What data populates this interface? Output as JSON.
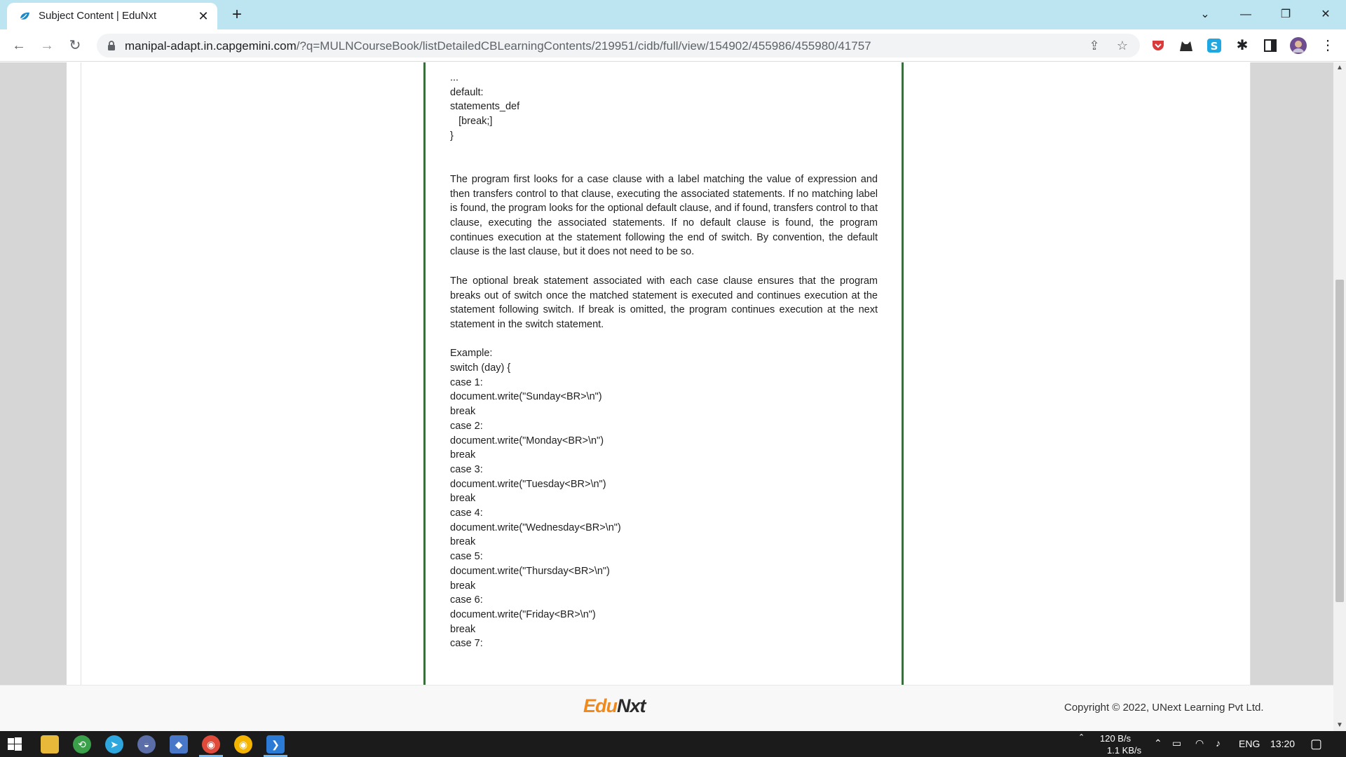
{
  "browser": {
    "tab_title": "Subject Content | EduNxt",
    "url_host": "manipal-adapt.in.capgemini.com",
    "url_path": "/?q=MULNCourseBook/listDetailedCBLearningContents/219951/cidb/full/view/154902/455986/455980/41757"
  },
  "content": {
    "code_top": [
      "...",
      "default:",
      "statements_def",
      "   [break;]",
      "}"
    ],
    "paragraphs": [
      "The program first looks for a case clause with a label matching the value of expression and then transfers control to that clause, executing the associated statements. If no matching label is found, the program looks for the optional default clause, and if found, transfers control to that clause, executing the associated statements. If no default clause is found, the program continues execution at the statement following the end of switch. By convention, the default clause is the last clause, but it does not need to be so.",
      "The optional break statement associated with each case clause ensures that the program breaks out of switch once the matched statement is executed and continues execution at the statement following switch. If break is omitted, the program continues execution at the next statement in the switch statement."
    ],
    "example_label": "Example:",
    "example_lines": [
      "switch (day) {",
      "case 1:",
      "document.write(\"Sunday<BR>\\n\")",
      "break",
      "case 2:",
      "document.write(\"Monday<BR>\\n\")",
      "break",
      "case 3:",
      "document.write(\"Tuesday<BR>\\n\")",
      "break",
      "case 4:",
      "document.write(\"Wednesday<BR>\\n\")",
      "break",
      "case 5:",
      "document.write(\"Thursday<BR>\\n\")",
      "break",
      "case 6:",
      "document.write(\"Friday<BR>\\n\")",
      "break",
      "case 7:"
    ]
  },
  "footer": {
    "logo_edu": "Edu",
    "logo_nxt": "Nxt",
    "copyright": "Copyright © 2022, UNext Learning Pvt Ltd."
  },
  "taskbar": {
    "net_up": "120 B/s",
    "net_down": "1.1 KB/s",
    "lang": "ENG",
    "time": "13:20"
  },
  "colors": {
    "accent_border": "#3b6e3d",
    "logo_orange": "#f08a1c",
    "tab_strip": "#bde5f1"
  }
}
